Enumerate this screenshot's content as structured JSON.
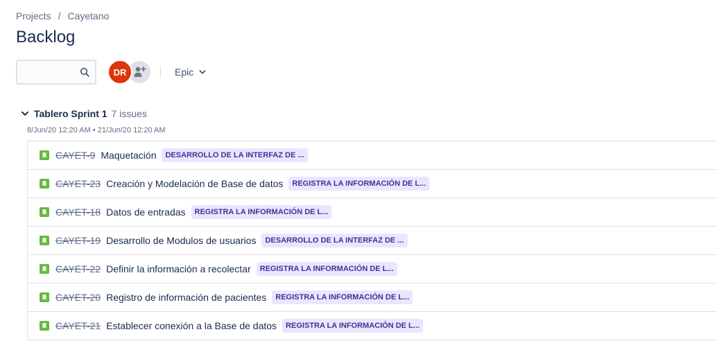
{
  "breadcrumb": {
    "projects": "Projects",
    "separator": "/",
    "project": "Cayetano"
  },
  "page": {
    "title": "Backlog"
  },
  "toolbar": {
    "search_placeholder": "",
    "search_icon": "search-icon",
    "avatar_initials": "DR",
    "avatar_color": "#DE350B",
    "add_people_icon": "add-person-icon",
    "epic_filter_label": "Epic"
  },
  "sprint": {
    "name": "Tablero Sprint 1",
    "issue_count": "7 issues",
    "dates": "8/Jun/20 12:20 AM • 21/Jun/20 12:20 AM"
  },
  "colors": {
    "story_icon": "#63BA3C",
    "epic_bg": "#EAE6FF",
    "epic_text": "#403294",
    "title_text": "#172B4D"
  },
  "issues": [
    {
      "key": "CAYET-9",
      "summary": "Maquetación",
      "epic": "DESARROLLO DE LA INTERFAZ DE ..."
    },
    {
      "key": "CAYET-23",
      "summary": "Creación y Modelación de Base de datos",
      "epic": "REGISTRA LA INFORMACIÓN DE L..."
    },
    {
      "key": "CAYET-18",
      "summary": "Datos de entradas",
      "epic": "REGISTRA LA INFORMACIÓN DE L..."
    },
    {
      "key": "CAYET-19",
      "summary": "Desarrollo de Modulos de usuarios",
      "epic": "DESARROLLO DE LA INTERFAZ DE ..."
    },
    {
      "key": "CAYET-22",
      "summary": "Definir la información a recolectar",
      "epic": "REGISTRA LA INFORMACIÓN DE L..."
    },
    {
      "key": "CAYET-20",
      "summary": "Registro de información de pacientes",
      "epic": "REGISTRA LA INFORMACIÓN DE L..."
    },
    {
      "key": "CAYET-21",
      "summary": "Establecer conexión a la Base de datos",
      "epic": "REGISTRA LA INFORMACIÓN DE L..."
    }
  ]
}
